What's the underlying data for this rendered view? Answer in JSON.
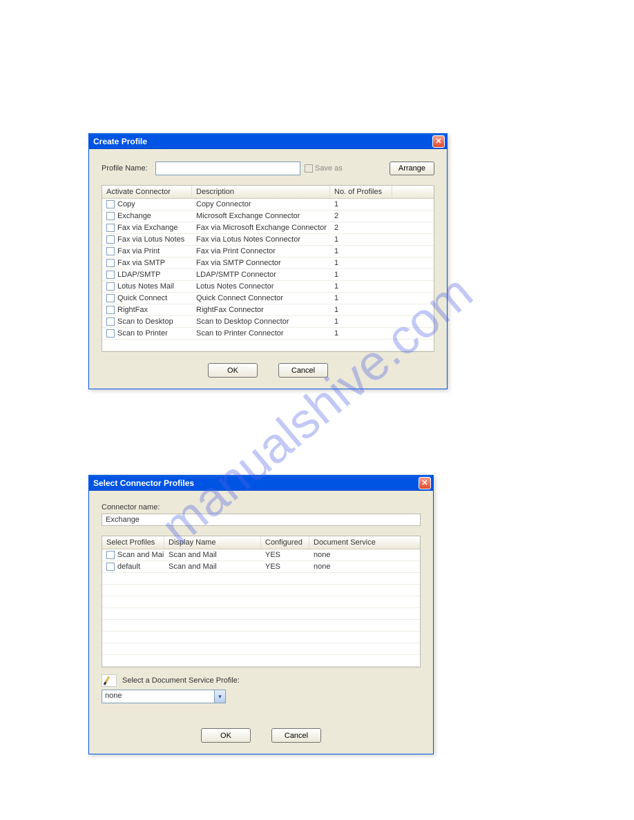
{
  "watermark": "manualshive.com",
  "dialog1": {
    "title": "Create Profile",
    "profile_name_label": "Profile Name:",
    "profile_name_value": "",
    "saveas_label": "Save as",
    "arrange_label": "Arrange",
    "headers": {
      "activate": "Activate Connector",
      "description": "Description",
      "profiles": "No. of Profiles"
    },
    "rows": [
      {
        "name": "Copy",
        "desc": "Copy Connector",
        "num": "1"
      },
      {
        "name": "Exchange",
        "desc": "Microsoft Exchange Connector",
        "num": "2"
      },
      {
        "name": "Fax via Exchange",
        "desc": "Fax via Microsoft Exchange Connector",
        "num": "2"
      },
      {
        "name": "Fax via Lotus Notes",
        "desc": "Fax via Lotus Notes Connector",
        "num": "1"
      },
      {
        "name": "Fax via Print",
        "desc": "Fax via Print Connector",
        "num": "1"
      },
      {
        "name": "Fax via SMTP",
        "desc": "Fax via SMTP Connector",
        "num": "1"
      },
      {
        "name": "LDAP/SMTP",
        "desc": "LDAP/SMTP Connector",
        "num": "1"
      },
      {
        "name": "Lotus Notes Mail",
        "desc": "Lotus Notes Connector",
        "num": "1"
      },
      {
        "name": "Quick Connect",
        "desc": "Quick Connect Connector",
        "num": "1"
      },
      {
        "name": "RightFax",
        "desc": "RightFax Connector",
        "num": "1"
      },
      {
        "name": "Scan to Desktop",
        "desc": "Scan to Desktop Connector",
        "num": "1"
      },
      {
        "name": "Scan to Printer",
        "desc": "Scan to Printer Connector",
        "num": "1"
      }
    ],
    "ok_label": "OK",
    "cancel_label": "Cancel"
  },
  "dialog2": {
    "title": "Select Connector Profiles",
    "connector_name_label": "Connector name:",
    "connector_name_value": "Exchange",
    "headers": {
      "select": "Select Profiles",
      "display": "Display Name",
      "configured": "Configured",
      "service": "Document Service"
    },
    "rows": [
      {
        "name": "Scan and Mail",
        "display": "Scan and Mail",
        "conf": "YES",
        "svc": "none"
      },
      {
        "name": "default",
        "display": "Scan and Mail",
        "conf": "YES",
        "svc": "none"
      }
    ],
    "dsp_label": "Select a Document Service Profile:",
    "dsp_value": "none",
    "ok_label": "OK",
    "cancel_label": "Cancel"
  }
}
